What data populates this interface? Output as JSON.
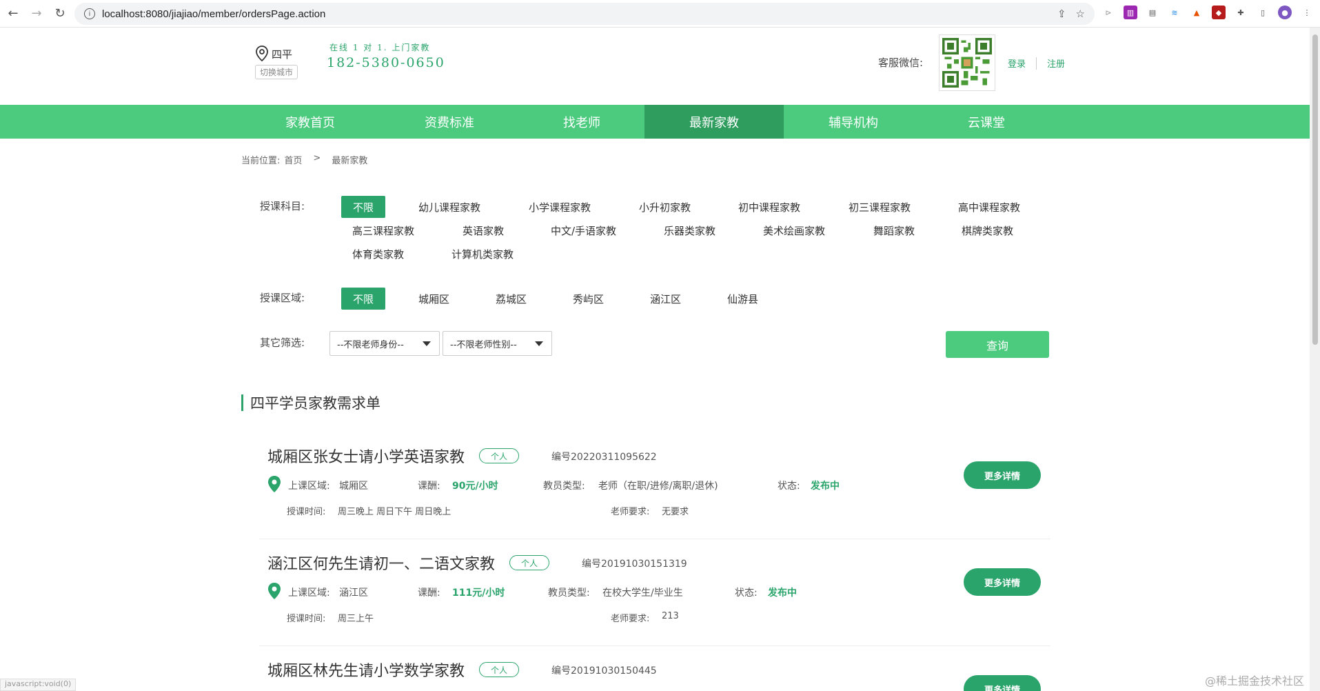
{
  "browser": {
    "url": "localhost:8080/jiajiao/member/ordersPage.action"
  },
  "header": {
    "city": "四平",
    "switch_city": "切换城市",
    "slogan": "在线 1 对 1. 上门家教",
    "phone": "182-5380-0650",
    "wechat_label": "客服微信:",
    "login": "登录",
    "register": "注册"
  },
  "nav": {
    "items": [
      {
        "label": "家教首页"
      },
      {
        "label": "资费标准"
      },
      {
        "label": "找老师"
      },
      {
        "label": "最新家教"
      },
      {
        "label": "辅导机构"
      },
      {
        "label": "云课堂"
      }
    ],
    "active_index": 3
  },
  "breadcrumb": {
    "prefix": "当前位置:",
    "home": "首页",
    "separator": ">",
    "current": "最新家教"
  },
  "filters": {
    "subject_label": "授课科目:",
    "subjects": [
      "不限",
      "幼儿课程家教",
      "小学课程家教",
      "小升初家教",
      "初中课程家教",
      "初三课程家教",
      "高中课程家教",
      "高三课程家教",
      "英语家教",
      "中文/手语家教",
      "乐器类家教",
      "美术绘画家教",
      "舞蹈家教",
      "棋牌类家教",
      "体育类家教",
      "计算机类家教"
    ],
    "area_label": "授课区域:",
    "areas": [
      "不限",
      "城厢区",
      "荔城区",
      "秀屿区",
      "涵江区",
      "仙游县"
    ],
    "other_label": "其它筛选:",
    "teacher_identity": "--不限老师身份--",
    "teacher_gender": "--不限老师性别--",
    "query_button": "查询"
  },
  "section_title": "四平学员家教需求单",
  "orders": [
    {
      "title": "城厢区张女士请小学英语家教",
      "badge": "个人",
      "number": "编号20220311095622",
      "area_label": "上课区域:",
      "area": "城厢区",
      "pay_label": "课酬:",
      "pay": "90元/小时",
      "type_label": "教员类型:",
      "type": "老师（在职/进修/离职/退休)",
      "status_label": "状态:",
      "status": "发布中",
      "time_label": "授课时间:",
      "time": "周三晚上 周日下午 周日晚上",
      "req_label": "老师要求:",
      "req": "无要求",
      "detail": "更多详情"
    },
    {
      "title": "涵江区何先生请初一、二语文家教",
      "badge": "个人",
      "number": "编号20191030151319",
      "area_label": "上课区域:",
      "area": "涵江区",
      "pay_label": "课酬:",
      "pay": "111元/小时",
      "type_label": "教员类型:",
      "type": "在校大学生/毕业生",
      "status_label": "状态:",
      "status": "发布中",
      "time_label": "授课时间:",
      "time": "周三上午",
      "req_label": "老师要求:",
      "req": "213",
      "detail": "更多详情"
    },
    {
      "title": "城厢区林先生请小学数学家教",
      "badge": "个人",
      "number": "编号20191030150445",
      "detail": "更多详情"
    }
  ],
  "status_url": "javascript:void(0)",
  "watermark": "@稀土掘金技术社区",
  "colors": {
    "brand_green": "#4ccb7f",
    "dark_green": "#2aa46b",
    "nav_active": "#2f9d5e"
  }
}
